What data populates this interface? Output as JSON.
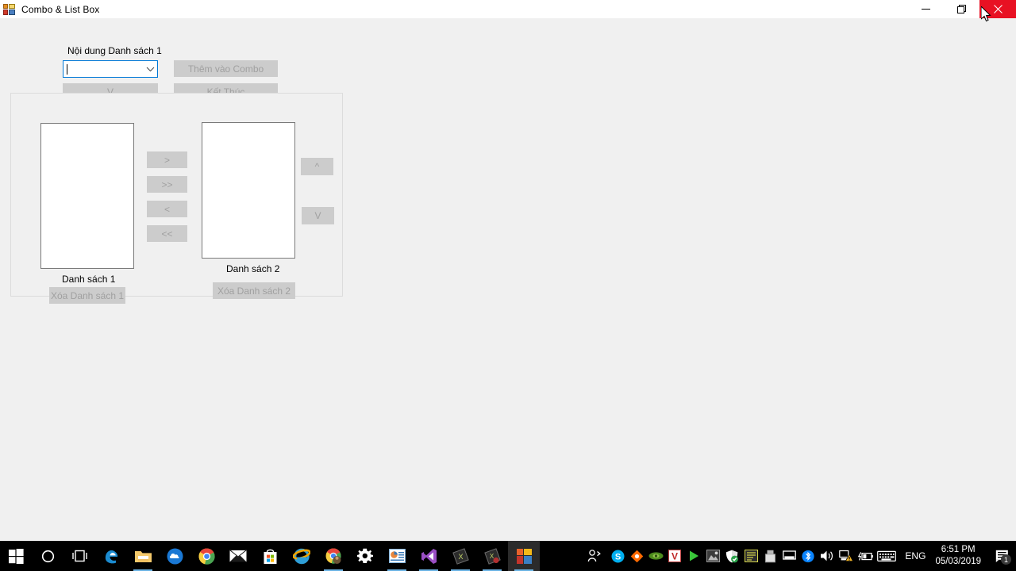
{
  "window": {
    "title": "Combo & List Box",
    "icon": "winforms-app-icon",
    "controls": {
      "minimize": "minimize-icon",
      "maximize": "maximize-icon",
      "close": "close-icon",
      "close_hover_color": "#e81123"
    }
  },
  "form": {
    "combo_label": "Nội dung Danh sách 1",
    "combo": {
      "value": "",
      "placeholder": "",
      "focused": true,
      "focus_border_color": "#0078d7",
      "arrow_icon": "chevron-down-icon"
    },
    "buttons": {
      "down_under_combo": "V",
      "add_to_combo": "Thêm vào Combo",
      "finish": "Kết Thúc",
      "move_right": ">",
      "move_right_all": ">>",
      "move_left": "<",
      "move_left_all": "<<",
      "move_up": "^",
      "move_down": "V",
      "clear_list_1": "Xóa Danh sách 1",
      "clear_list_2": "Xóa Danh sách 2"
    },
    "list_1": {
      "label": "Danh sách 1",
      "items": []
    },
    "list_2": {
      "label": "Danh sách 2",
      "items": []
    },
    "disabled_button_color": "#cccccc",
    "disabled_text_color": "#a0a0a0"
  },
  "taskbar": {
    "pinned": [
      {
        "name": "start-button",
        "icon": "windows-logo-icon"
      },
      {
        "name": "cortana-search",
        "icon": "circle-icon"
      },
      {
        "name": "task-view",
        "icon": "task-view-icon"
      },
      {
        "name": "microsoft-edge",
        "icon": "edge-icon"
      },
      {
        "name": "file-explorer",
        "icon": "folder-icon"
      },
      {
        "name": "onedrive",
        "icon": "cloud-icon"
      },
      {
        "name": "google-chrome",
        "icon": "chrome-icon"
      },
      {
        "name": "mail",
        "icon": "envelope-icon"
      },
      {
        "name": "microsoft-store",
        "icon": "store-bag-icon"
      },
      {
        "name": "internet-explorer",
        "icon": "ie-icon"
      },
      {
        "name": "chrome-profile",
        "icon": "chrome-icon"
      },
      {
        "name": "settings",
        "icon": "gear-icon"
      },
      {
        "name": "powerpoint",
        "icon": "presentation-icon"
      },
      {
        "name": "visual-studio",
        "icon": "visual-studio-icon"
      },
      {
        "name": "app-dark-1",
        "icon": "diamond-icon"
      },
      {
        "name": "app-dark-2",
        "icon": "diamond-icon"
      },
      {
        "name": "combo-list-box-app",
        "icon": "winforms-app-icon"
      }
    ],
    "tray": [
      {
        "name": "people",
        "icon": "people-icon"
      },
      {
        "name": "skype",
        "icon": "skype-icon"
      },
      {
        "name": "avast",
        "icon": "avast-icon"
      },
      {
        "name": "nvidia",
        "icon": "nvidia-icon"
      },
      {
        "name": "v-app",
        "icon": "v-letter-icon"
      },
      {
        "name": "media-player",
        "icon": "play-icon"
      },
      {
        "name": "photo-app",
        "icon": "picture-icon"
      },
      {
        "name": "security",
        "icon": "shield-check-icon"
      },
      {
        "name": "note-app",
        "icon": "note-icon"
      },
      {
        "name": "usb-eject",
        "icon": "usb-icon"
      },
      {
        "name": "display",
        "icon": "monitor-icon"
      },
      {
        "name": "bluetooth",
        "icon": "bluetooth-icon"
      },
      {
        "name": "volume",
        "icon": "speaker-icon"
      },
      {
        "name": "network",
        "icon": "network-warning-icon"
      },
      {
        "name": "battery",
        "icon": "battery-icon"
      },
      {
        "name": "touch-keyboard",
        "icon": "keyboard-icon"
      }
    ],
    "language": "ENG",
    "clock": {
      "time": "6:51 PM",
      "date": "05/03/2019"
    },
    "notifications": {
      "icon": "action-center-icon",
      "count": "1"
    }
  }
}
